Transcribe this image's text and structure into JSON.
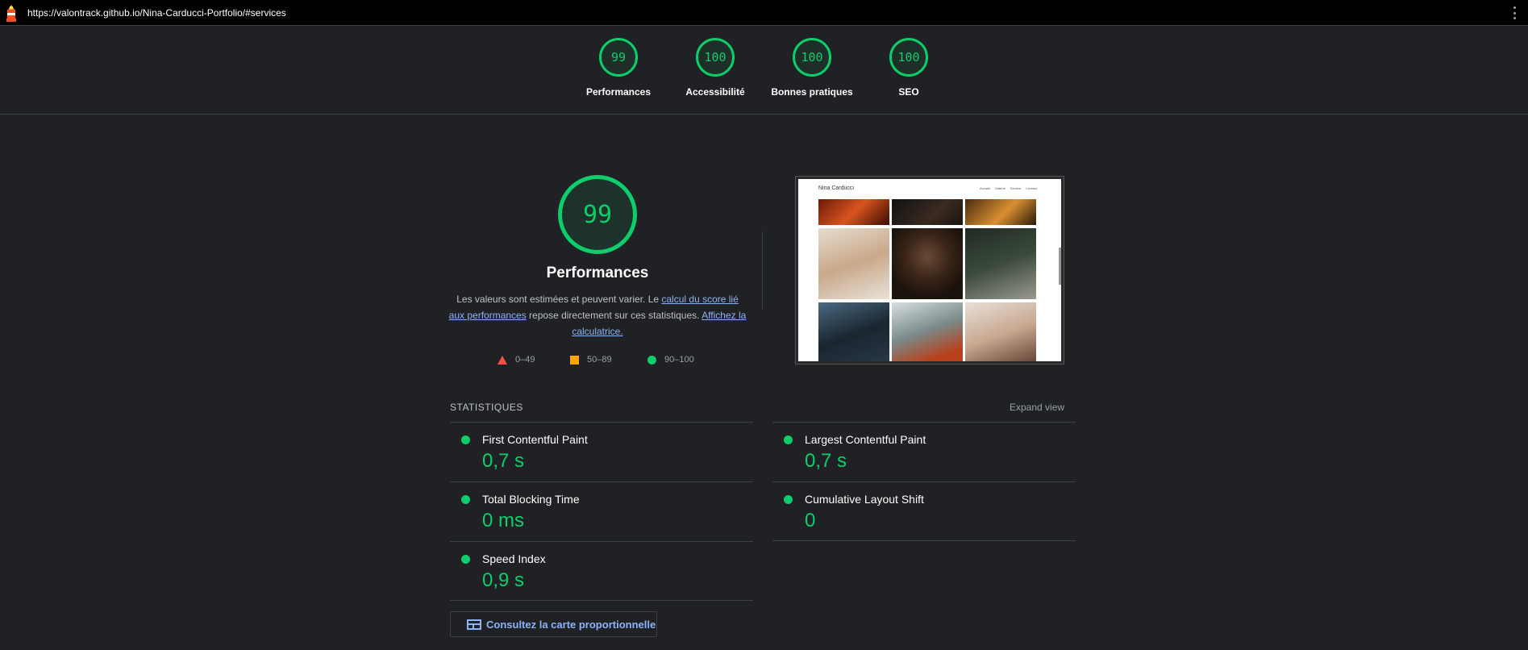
{
  "topbar": {
    "url": "https://valontrack.github.io/Nina-Carducci-Portfolio/#services",
    "logo_icon": "lighthouse-icon",
    "menu_icon": "kebab-menu-icon"
  },
  "scores": [
    {
      "value": "99",
      "label": "Performances"
    },
    {
      "value": "100",
      "label": "Accessibilité"
    },
    {
      "value": "100",
      "label": "Bonnes pratiques"
    },
    {
      "value": "100",
      "label": "SEO"
    }
  ],
  "performance": {
    "score": "99",
    "title": "Performances",
    "desc_1": "Les valeurs sont estimées et peuvent varier. Le ",
    "link_1": "calcul du score lié aux performances",
    "desc_2": " repose directement sur ces statistiques. ",
    "link_2": "Affichez la calculatrice."
  },
  "legend": {
    "fail": "0–49",
    "average": "50–89",
    "pass": "90–100"
  },
  "screenshot": {
    "site_name": "Nina Carducci",
    "nav": [
      "Accueil",
      "Galerie",
      "Service",
      "Contact"
    ]
  },
  "stats": {
    "header": "STATISTIQUES",
    "expand": "Expand view",
    "metrics": [
      {
        "label": "First Contentful Paint",
        "value": "0,7 s"
      },
      {
        "label": "Largest Contentful Paint",
        "value": "0,7 s"
      },
      {
        "label": "Total Blocking Time",
        "value": "0 ms"
      },
      {
        "label": "Cumulative Layout Shift",
        "value": "0"
      },
      {
        "label": "Speed Index",
        "value": "0,9 s"
      }
    ]
  },
  "treemap_button": "Consultez la carte proportionnelle",
  "colors": {
    "pass": "#0cce6b",
    "average": "#ffa400",
    "fail": "#ff4e42",
    "link": "#8ab4f8",
    "background": "#202124"
  }
}
